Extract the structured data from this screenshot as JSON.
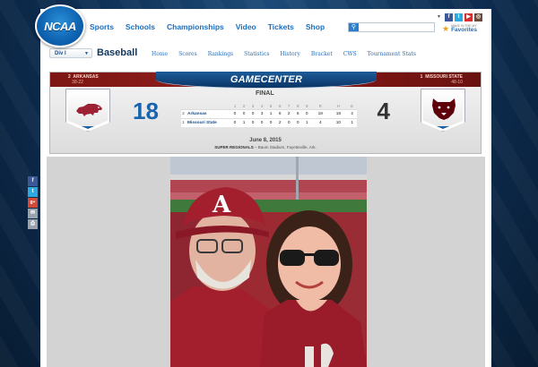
{
  "brand": {
    "logo_text": "NCAA"
  },
  "main_nav": [
    "Sports",
    "Schools",
    "Championships",
    "Video",
    "Tickets",
    "Shop"
  ],
  "search": {
    "placeholder": "",
    "button_icon": "search-icon"
  },
  "social_top": [
    {
      "name": "facebook",
      "glyph": "f",
      "color": "#3b5998"
    },
    {
      "name": "twitter",
      "glyph": "t",
      "color": "#2ba9e1"
    },
    {
      "name": "youtube",
      "glyph": "▶",
      "color": "#d32f2f"
    },
    {
      "name": "instagram",
      "glyph": "◎",
      "color": "#6b4a3a"
    }
  ],
  "favorites": {
    "small": "MAKE IN THE MY",
    "label": "Favorites"
  },
  "subnav": {
    "division": "Div I",
    "sport": "Baseball",
    "links": [
      "Home",
      "Scores",
      "Rankings",
      "Statistics",
      "History",
      "Bracket",
      "CWS",
      "Tournament Stats"
    ]
  },
  "gamecenter": {
    "title": "GAMECENTER",
    "away": {
      "seed": "2",
      "name": "ARKANSAS",
      "record": "38-22",
      "score": "18"
    },
    "home": {
      "seed": "1",
      "name": "MISSOURI STATE",
      "record": "48-10",
      "score": "4"
    },
    "status": "FINAL",
    "innings": [
      "1",
      "2",
      "3",
      "4",
      "5",
      "6",
      "7",
      "8",
      "9",
      "R",
      "H",
      "E"
    ],
    "line": [
      {
        "seed": "2",
        "name": "Arkansas",
        "runs": [
          "0",
          "0",
          "0",
          "3",
          "1",
          "6",
          "2",
          "6",
          "0",
          "18",
          "18",
          "2"
        ]
      },
      {
        "seed": "1",
        "name": "Missouri State",
        "runs": [
          "0",
          "1",
          "0",
          "0",
          "0",
          "2",
          "0",
          "0",
          "1",
          "4",
          "10",
          "1"
        ]
      }
    ],
    "date": "June 8, 2015",
    "round": "SUPER REGIONALS",
    "venue": "Baum Stadium, Fayetteville, Ark."
  },
  "share_bar": [
    {
      "name": "facebook",
      "glyph": "f",
      "color": "#3b5998"
    },
    {
      "name": "twitter",
      "glyph": "t",
      "color": "#2ba9e1"
    },
    {
      "name": "google-plus",
      "glyph": "g+",
      "color": "#d34836"
    },
    {
      "name": "email",
      "glyph": "✉",
      "color": "#9aa3ad"
    },
    {
      "name": "print",
      "glyph": "⎙",
      "color": "#9aa3ad"
    }
  ],
  "colors": {
    "ncaa_blue": "#1a6fc0",
    "arkansas_red": "#9d2235",
    "missouri_state_maroon": "#5e0009"
  }
}
